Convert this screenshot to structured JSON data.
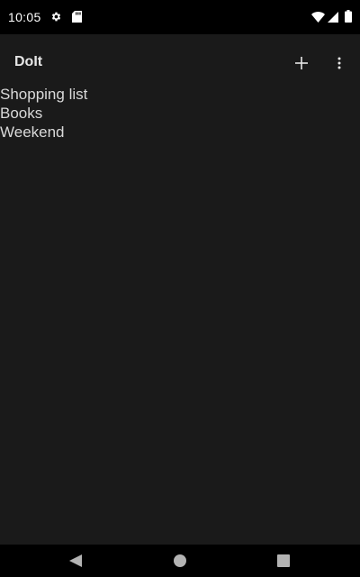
{
  "status_bar": {
    "time": "10:05",
    "icons": [
      "gear-icon",
      "sd-card-icon",
      "wifi-icon",
      "signal-icon",
      "battery-icon"
    ]
  },
  "app_bar": {
    "title": "DoIt",
    "actions": [
      "add-icon",
      "overflow-menu-icon"
    ]
  },
  "lists": {
    "items": [
      {
        "label": "Shopping list"
      },
      {
        "label": "Books"
      },
      {
        "label": "Weekend"
      }
    ]
  },
  "nav_bar": {
    "buttons": [
      "back-icon",
      "home-icon",
      "recents-icon"
    ]
  },
  "colors": {
    "status_bar_bg": "#000000",
    "app_bg": "#1a1a1a",
    "text_primary": "#d9d9d9",
    "title_text": "#e6e6e6"
  }
}
